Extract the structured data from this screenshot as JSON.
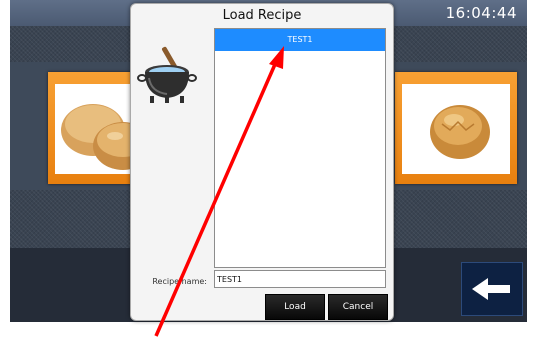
{
  "status_bar": {
    "time": "16:04:44"
  },
  "icons": {
    "left_panel": "bread-rolls-icon",
    "right_panel": "bread-bun-icon",
    "back": "back-arrow-icon",
    "pot": "cooking-pot-icon"
  },
  "dialog": {
    "title": "Load Recipe",
    "recipes": [
      {
        "name": "TEST1",
        "selected": true
      }
    ],
    "recipe_name_label": "Recipe name:",
    "recipe_name_value": "TEST1",
    "load_label": "Load",
    "cancel_label": "Cancel"
  },
  "colors": {
    "selection": "#1e8cff",
    "panel_orange": "#f08a1c",
    "annotation_arrow": "#ff0000"
  }
}
